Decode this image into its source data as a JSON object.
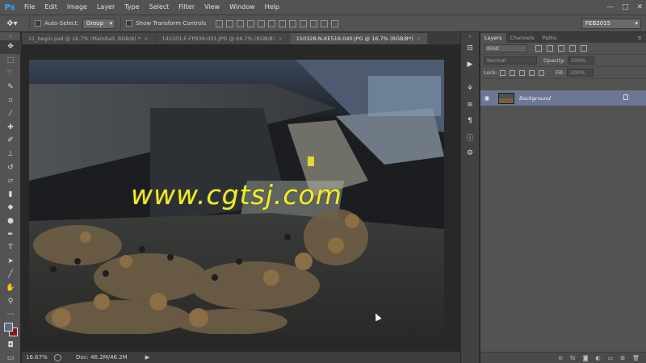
{
  "app": {
    "logo": "Ps"
  },
  "menu": [
    "File",
    "Edit",
    "Image",
    "Layer",
    "Type",
    "Select",
    "Filter",
    "View",
    "Window",
    "Help"
  ],
  "window_controls": {
    "minimize": "—",
    "maximize": "□",
    "close": "✕"
  },
  "options_bar": {
    "auto_select_label": "Auto-Select:",
    "auto_select_value": "Group",
    "transform_label": "Show Transform Controls",
    "workspace": "FEB2015"
  },
  "tabs": [
    {
      "label": "11_begin.psd @ 16.7% (MainRail, RGB/8) *",
      "active": false
    },
    {
      "label": "141201-F-FP939-001.JPG @ 66.7% (RGB/8)",
      "active": false
    },
    {
      "label": "150328-N-KE519-040.JPG @ 16.7% (RGB/8*)",
      "active": true
    }
  ],
  "canvas": {
    "watermark": "www.cgtsj.com"
  },
  "status": {
    "zoom": "16.67%",
    "doc": "Doc: 46.2M/46.2M",
    "arrow": "▶"
  },
  "panel": {
    "tabs": [
      "Layers",
      "Channels",
      "Paths"
    ],
    "kind_label": "Kind",
    "blend_mode": "Normal",
    "opacity_label": "Opacity:",
    "opacity_value": "100%",
    "lock_label": "Lock:",
    "fill_label": "Fill:",
    "fill_value": "100%",
    "layers": [
      {
        "name": "Background",
        "visible": true,
        "locked": true
      }
    ],
    "bottom_icons": [
      "⊝",
      "fx",
      "◙",
      "◐",
      "▭",
      "⊞",
      "🗑"
    ]
  },
  "colors": {
    "foreground": "#5b6a87",
    "background": "#7a1b1b",
    "watermark": "#f2ee1e",
    "selected_layer": "#6b7894"
  }
}
